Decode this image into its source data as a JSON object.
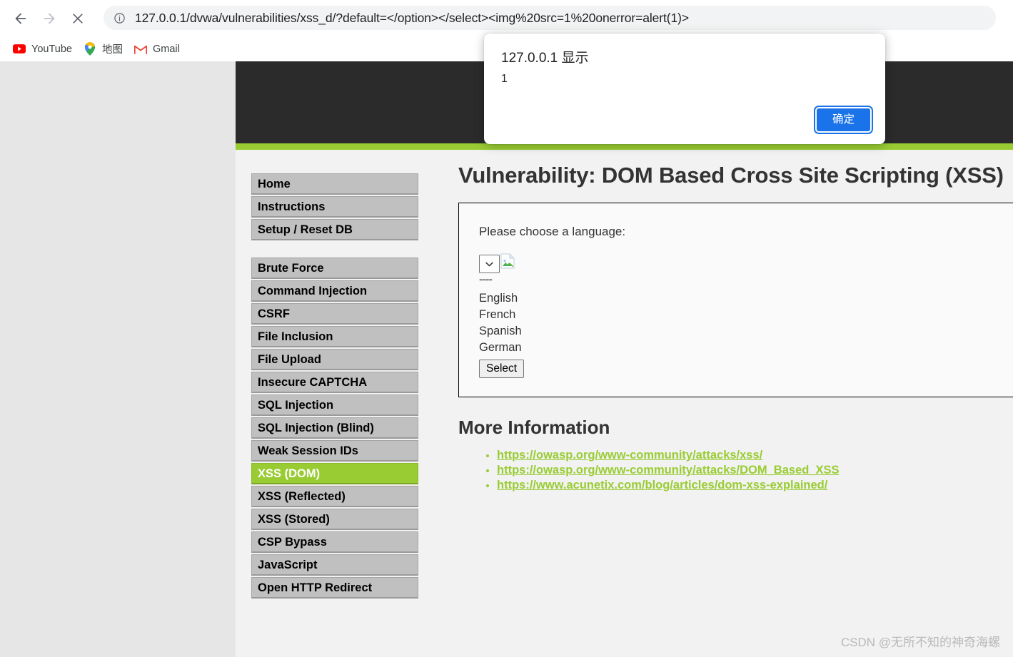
{
  "browser": {
    "nav": {
      "back_label": "Back",
      "forward_label": "Forward",
      "stop_label": "Stop"
    },
    "omnibox": {
      "url": "127.0.0.1/dvwa/vulnerabilities/xss_d/?default=</option></select><img%20src=1%20onerror=alert(1)>",
      "security_icon": "info-circle-icon"
    },
    "bookmarks": [
      {
        "label": "YouTube",
        "icon": "youtube-icon"
      },
      {
        "label": "地图",
        "icon": "google-maps-pin-icon"
      },
      {
        "label": "Gmail",
        "icon": "gmail-icon"
      }
    ]
  },
  "dialog": {
    "title": "127.0.0.1 显示",
    "message": "1",
    "ok_label": "确定",
    "accent_color": "#1a73e8"
  },
  "page": {
    "title": "Vulnerability: DOM Based Cross Site Scripting (XSS)",
    "accent_color": "#99cc33",
    "header_color": "#2b2b2b",
    "nav_groups": [
      {
        "items": [
          {
            "label": "Home",
            "active": false
          },
          {
            "label": "Instructions",
            "active": false
          },
          {
            "label": "Setup / Reset DB",
            "active": false
          }
        ]
      },
      {
        "items": [
          {
            "label": "Brute Force",
            "active": false
          },
          {
            "label": "Command Injection",
            "active": false
          },
          {
            "label": "CSRF",
            "active": false
          },
          {
            "label": "File Inclusion",
            "active": false
          },
          {
            "label": "File Upload",
            "active": false
          },
          {
            "label": "Insecure CAPTCHA",
            "active": false
          },
          {
            "label": "SQL Injection",
            "active": false
          },
          {
            "label": "SQL Injection (Blind)",
            "active": false
          },
          {
            "label": "Weak Session IDs",
            "active": false
          },
          {
            "label": "XSS (DOM)",
            "active": true
          },
          {
            "label": "XSS (Reflected)",
            "active": false
          },
          {
            "label": "XSS (Stored)",
            "active": false
          },
          {
            "label": "CSP Bypass",
            "active": false
          },
          {
            "label": "JavaScript",
            "active": false
          },
          {
            "label": "Open HTTP Redirect",
            "active": false
          }
        ]
      }
    ],
    "form": {
      "prompt": "Please choose a language:",
      "select_value": "",
      "broken_image_alt": "broken-image",
      "leaked_separator": "----",
      "leaked_options": [
        "English",
        "French",
        "Spanish",
        "German"
      ],
      "submit_label": "Select"
    },
    "more_information": {
      "heading": "More Information",
      "links": [
        "https://owasp.org/www-community/attacks/xss/",
        "https://owasp.org/www-community/attacks/DOM_Based_XSS",
        "https://www.acunetix.com/blog/articles/dom-xss-explained/"
      ]
    }
  },
  "watermark": {
    "text": "CSDN @无所不知的神奇海螺"
  }
}
